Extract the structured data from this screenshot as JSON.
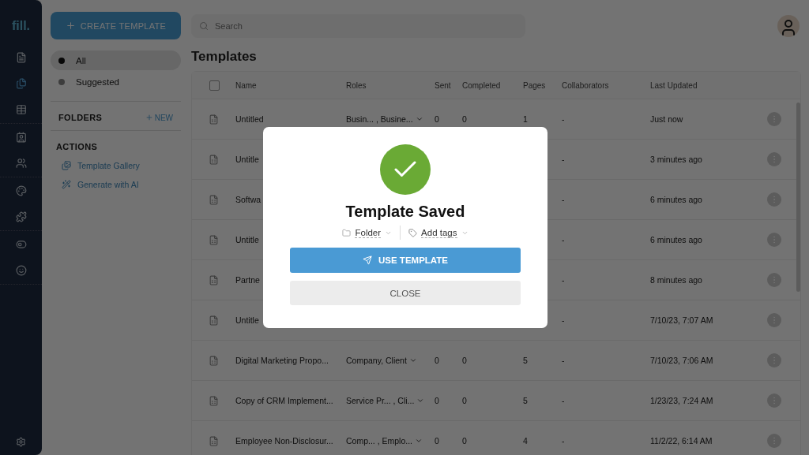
{
  "rail": {
    "logo": "fill.",
    "groups": [
      [
        {
          "selected": false
        },
        {
          "selected": true
        },
        {
          "selected": false
        }
      ],
      [
        {
          "selected": false
        },
        {
          "selected": false
        }
      ],
      [
        {
          "selected": false
        },
        {
          "selected": false
        }
      ],
      [
        {
          "selected": false
        },
        {
          "selected": false
        }
      ]
    ],
    "settings": {
      "selected": false
    }
  },
  "sidebar": {
    "create_button": "CREATE TEMPLATE",
    "filters": [
      {
        "label": "All",
        "selected": true
      },
      {
        "label": "Suggested",
        "selected": false
      }
    ],
    "folders": {
      "title": "FOLDERS",
      "new_button": "NEW"
    },
    "actions": {
      "title": "ACTIONS",
      "items": [
        {
          "label": "Template Gallery"
        },
        {
          "label": "Generate with AI"
        }
      ]
    }
  },
  "search": {
    "placeholder": "Search"
  },
  "page_title": "Templates",
  "table": {
    "select_all": {
      "checked": false
    },
    "columns": [
      "Name",
      "Roles",
      "Sent",
      "Completed",
      "Pages",
      "Collaborators",
      "Last Updated"
    ],
    "rows": [
      {
        "name": "Untitled",
        "roles": "Busin... , Busine...",
        "sent": "0",
        "completed": "0",
        "pages": "1",
        "collaborators": "-",
        "updated": "Just now"
      },
      {
        "name": "Untitle",
        "collaborators": "-",
        "updated": "3 minutes ago"
      },
      {
        "name": "Softwa",
        "collaborators": "-",
        "updated": "6 minutes ago"
      },
      {
        "name": "Untitle",
        "collaborators": "-",
        "updated": "6 minutes ago"
      },
      {
        "name": "Partne",
        "collaborators": "-",
        "updated": "8 minutes ago"
      },
      {
        "name": "Untitle",
        "collaborators": "-",
        "updated": "7/10/23, 7:07 AM"
      },
      {
        "name": "Digital Marketing Propo...",
        "roles": "Company, Client",
        "sent": "0",
        "completed": "0",
        "pages": "5",
        "collaborators": "-",
        "updated": "7/10/23, 7:06 AM"
      },
      {
        "name": "Copy of CRM Implement...",
        "roles": "Service Pr... , Cli...",
        "sent": "0",
        "completed": "0",
        "pages": "5",
        "collaborators": "-",
        "updated": "1/23/23, 7:24 AM"
      },
      {
        "name": "Employee Non-Disclosur...",
        "roles": "Comp... , Emplo...",
        "sent": "0",
        "completed": "0",
        "pages": "4",
        "collaborators": "-",
        "updated": "11/2/22, 6:14 AM"
      }
    ]
  },
  "modal": {
    "title": "Template Saved",
    "folder": "Folder",
    "tags": "Add tags",
    "primary_button": "USE TEMPLATE",
    "secondary_button": "CLOSE"
  }
}
